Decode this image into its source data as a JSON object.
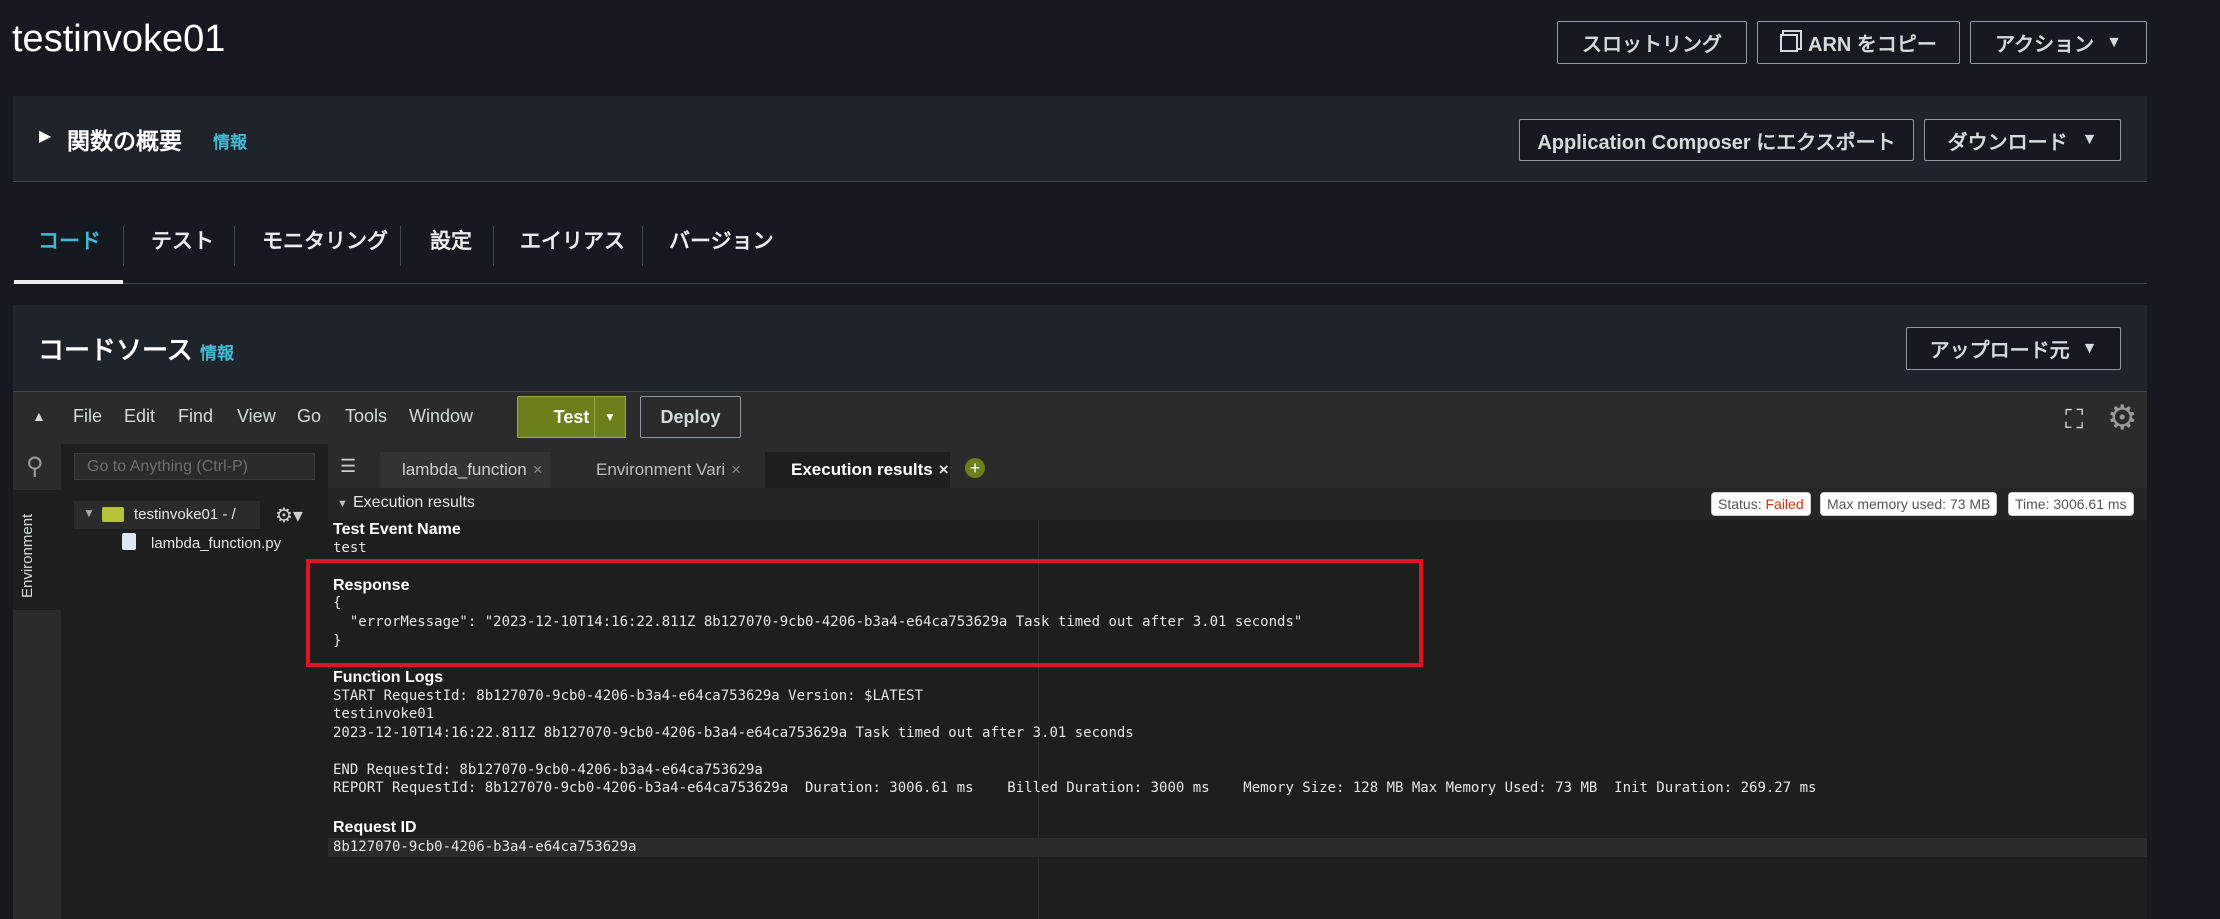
{
  "page": {
    "title": "testinvoke01",
    "top_buttons": {
      "throttle": "スロットリング",
      "copy_arn": "ARN をコピー",
      "actions": "アクション"
    }
  },
  "overview": {
    "title": "関数の概要",
    "info": "情報",
    "export": "Application Composer にエクスポート",
    "download": "ダウンロード"
  },
  "tabs": [
    "コード",
    "テスト",
    "モニタリング",
    "設定",
    "エイリアス",
    "バージョン"
  ],
  "code_source": {
    "title": "コードソース",
    "info": "情報",
    "upload": "アップロード元"
  },
  "ide": {
    "menu": [
      "File",
      "Edit",
      "Find",
      "View",
      "Go",
      "Tools",
      "Window"
    ],
    "test_label": "Test",
    "deploy_label": "Deploy",
    "goto_placeholder": "Go to Anything (Ctrl-P)",
    "env_label": "Environment",
    "folder": "testinvoke01 - /",
    "file": "lambda_function.py",
    "editor_tabs": [
      "lambda_function",
      "Environment Vari",
      "Execution results"
    ],
    "results_header": "Execution results",
    "status_label": "Status:",
    "status_value": "Failed",
    "max_memory": "Max memory used: 73 MB",
    "time": "Time: 3006.61 ms",
    "test_event_label": "Test Event Name",
    "test_event_value": "test",
    "response_label": "Response",
    "response_lines": [
      "{",
      "  \"errorMessage\": \"2023-12-10T14:16:22.811Z 8b127070-9cb0-4206-b3a4-e64ca753629a Task timed out after 3.01 seconds\"",
      "}"
    ],
    "logs_label": "Function Logs",
    "log_lines": [
      "START RequestId: 8b127070-9cb0-4206-b3a4-e64ca753629a Version: $LATEST",
      "testinvoke01",
      "2023-12-10T14:16:22.811Z 8b127070-9cb0-4206-b3a4-e64ca753629a Task timed out after 3.01 seconds",
      "",
      "END RequestId: 8b127070-9cb0-4206-b3a4-e64ca753629a",
      "REPORT RequestId: 8b127070-9cb0-4206-b3a4-e64ca753629a  Duration: 3006.61 ms    Billed Duration: 3000 ms    Memory Size: 128 MB Max Memory Used: 73 MB  Init Duration: 269.27 ms"
    ],
    "request_id_label": "Request ID",
    "request_id_value": "8b127070-9cb0-4206-b3a4-e64ca753629a"
  },
  "colors": {
    "accent": "#44b9d6",
    "test_button": "#6b7f1a",
    "failed": "#d13212",
    "highlight_box": "#e0141e"
  }
}
